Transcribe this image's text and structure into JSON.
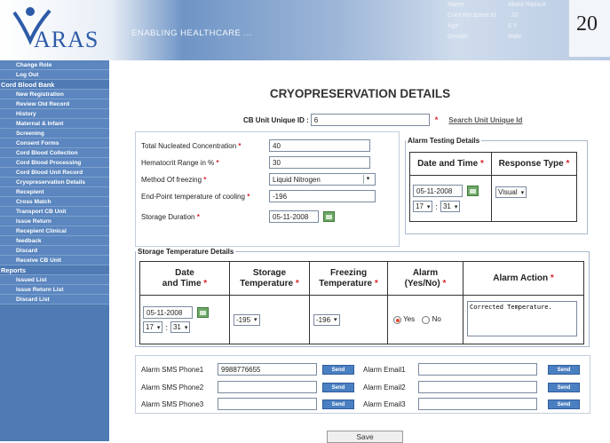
{
  "header": {
    "logo_text": "ARAS",
    "tagline": "ENABLING HEALTHCARE ...",
    "patient": [
      {
        "label": "Name",
        "value": "Abdul Razack"
      },
      {
        "label": "Cord Recipient Id",
        "value": ": 20"
      },
      {
        "label": "Age",
        "value": "5 Y"
      },
      {
        "label": "Gender",
        "value": "Male"
      }
    ],
    "year": "20"
  },
  "sidebar": {
    "items": [
      {
        "label": "Change Role",
        "type": "item"
      },
      {
        "label": "Log Out",
        "type": "item"
      },
      {
        "label": "Cord Blood Bank",
        "type": "section"
      },
      {
        "label": "New Registration",
        "type": "item"
      },
      {
        "label": "Review Old Record",
        "type": "item"
      },
      {
        "label": "History",
        "type": "item"
      },
      {
        "label": "Maternal & Infant",
        "type": "item"
      },
      {
        "label": "Screening",
        "type": "item"
      },
      {
        "label": "Consent Forms",
        "type": "item"
      },
      {
        "label": "Cord Blood Collection",
        "type": "item"
      },
      {
        "label": "Cord Blood Processing",
        "type": "item"
      },
      {
        "label": "Cord Blood Unit Record",
        "type": "item"
      },
      {
        "label": "Cryopreservation Details",
        "type": "item"
      },
      {
        "label": "Recepient",
        "type": "item"
      },
      {
        "label": "Cross Match",
        "type": "item"
      },
      {
        "label": "Transport CB Unit",
        "type": "item"
      },
      {
        "label": "Issue Return",
        "type": "item"
      },
      {
        "label": "Recepient Clinical",
        "type": "item"
      },
      {
        "label": "feedback",
        "type": "item"
      },
      {
        "label": "Discard",
        "type": "item"
      },
      {
        "label": "Receive CB Unit",
        "type": "item"
      },
      {
        "label": "Reports",
        "type": "section"
      },
      {
        "label": "Issued List",
        "type": "item"
      },
      {
        "label": "Issue Return List",
        "type": "item"
      },
      {
        "label": "Discard List",
        "type": "item"
      }
    ]
  },
  "page": {
    "title": "CRYOPRESERVATION DETAILS",
    "cb_unit_label": "CB Unit Unique ID :",
    "cb_unit_value": "6",
    "search_link": "Search Unit Unique Id",
    "required_mark": "*"
  },
  "details": {
    "nucleated_label": "Total Nucleated Concentration",
    "nucleated_value": "40",
    "hematocrit_label": "Hematocrit Range in %",
    "hematocrit_value": "30",
    "method_label": "Method Of freezing",
    "method_value": "Liquid Nitrogen",
    "endpoint_label": "End-Point temperature of cooling",
    "endpoint_value": "-196",
    "duration_label": "Storage Duration",
    "duration_value": "05-11-2008"
  },
  "alarm_testing": {
    "legend": "Alarm Testing Details",
    "col_datetime": "Date and Time",
    "col_response": "Response Type",
    "date_value": "05-11-2008",
    "hour_value": "17",
    "minute_value": "31",
    "time_sep": ":",
    "response_value": "Visual"
  },
  "storage_temp": {
    "legend": "Storage Temperature Details",
    "col_date_1": "Date",
    "col_date_2": "and Time",
    "col_storage_1": "Storage",
    "col_storage_2": "Temperature",
    "col_freezing_1": "Freezing",
    "col_freezing_2": "Temperature",
    "col_alarm_1": "Alarm",
    "col_alarm_2": "(Yes/No)",
    "col_action": "Alarm Action",
    "date_value": "05-11-2008",
    "hour_value": "17",
    "minute_value": "31",
    "time_sep": ":",
    "storage_value": "-195",
    "freezing_value": "-196",
    "yes_label": "Yes",
    "no_label": "No",
    "alarm_selected": "Yes",
    "action_value": "Corrected Temperature."
  },
  "notifications": {
    "send_label": "Send",
    "phones": [
      {
        "label": "Alarm SMS Phone1",
        "value": "9988776655"
      },
      {
        "label": "Alarm SMS Phone2",
        "value": ""
      },
      {
        "label": "Alarm SMS Phone3",
        "value": ""
      }
    ],
    "emails": [
      {
        "label": "Alarm Email1",
        "value": ""
      },
      {
        "label": "Alarm Email2",
        "value": ""
      },
      {
        "label": "Alarm Email3",
        "value": ""
      }
    ]
  },
  "actions": {
    "save_label": "Save"
  },
  "colors": {
    "sidebar_bg": "#4f7ab4",
    "send_button": "#4a7fc1",
    "required": "#d9242a"
  }
}
